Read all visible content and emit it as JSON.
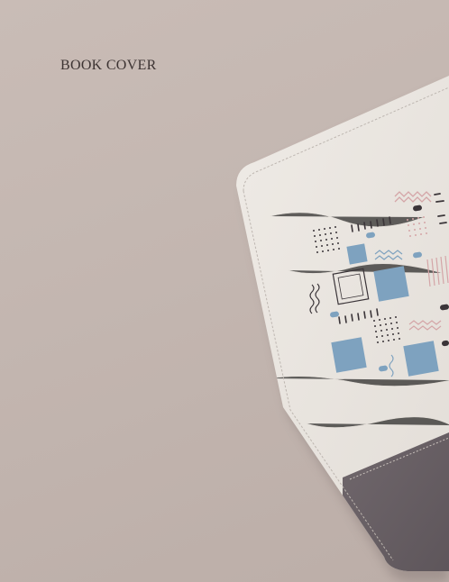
{
  "title": "BOOK COVER",
  "colors": {
    "background": "#c5b8b2",
    "cover_light": "#e9e5df",
    "cover_dark": "#6a6166",
    "accent_blue": "#7ea2bf",
    "accent_pink": "#d4a5a7",
    "ink": "#3a3438"
  }
}
